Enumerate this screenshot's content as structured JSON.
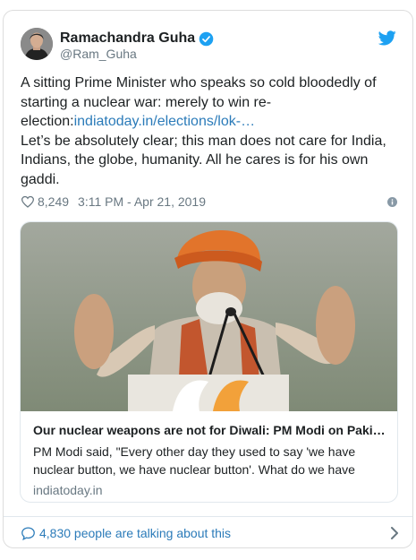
{
  "author": {
    "name": "Ramachandra Guha",
    "handle": "@Ram_Guha",
    "verified": true
  },
  "tweet": {
    "line1": "A sitting Prime Minister who speaks so cold bloodedly of starting a nuclear war: merely to win re-election:",
    "link_text": "indiatoday.in/elections/lok-…",
    "line2": "Let’s be absolutely clear; this man does not care for India, Indians, the globe, humanity. All he cares is for his own gaddi."
  },
  "meta": {
    "likes": "8,249",
    "timestamp": "3:11 PM - Apr 21, 2019"
  },
  "preview": {
    "title": "Our nuclear weapons are not for Diwali: PM Modi on Pakistan",
    "description": "PM Modi said, \"Every other day they used to say 'we have nuclear button, we have nuclear button'. What do we have",
    "domain": "indiatoday.in"
  },
  "footer": {
    "talking": "4,830 people are talking about this"
  },
  "icons": {
    "twitter": "twitter-bird-icon",
    "verified": "verified-badge-icon",
    "heart": "heart-icon",
    "info": "info-icon",
    "bubble": "speech-bubble-icon",
    "chevron": "chevron-right-icon"
  },
  "colors": {
    "twitter_blue": "#1da1f2",
    "link": "#2b7bb9",
    "muted": "#697882"
  }
}
